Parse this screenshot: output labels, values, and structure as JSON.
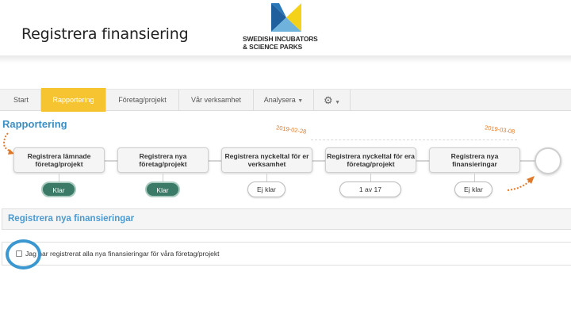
{
  "slide": {
    "title": "Registrera finansiering",
    "logo": {
      "line1": "SWEDISH INCUBATORS",
      "line2": "& SCIENCE PARKS"
    }
  },
  "colors": {
    "accent_yellow": "#f5c430",
    "title_blue": "#3c8fc4",
    "done_green": "#3b7a66",
    "annotation_orange": "#e07a2a",
    "highlight_blue": "#3a97cf"
  },
  "nav": {
    "items": [
      {
        "label": "Start"
      },
      {
        "label": "Rapportering",
        "active": true
      },
      {
        "label": "Företag/projekt"
      },
      {
        "label": "Vår verksamhet"
      },
      {
        "label": "Analysera",
        "caret": "▼"
      },
      {
        "icon": "gear-icon",
        "caret": "▼"
      }
    ]
  },
  "section_title": "Rapportering",
  "dates": {
    "start": "2019-02-28",
    "end": "2019-03-08"
  },
  "steps": [
    {
      "label": "Registrera lämnade företag/projekt",
      "status": "Klar"
    },
    {
      "label": "Registrera nya företag/projekt",
      "status": "Klar"
    },
    {
      "label": "Registrera nyckeltal för er verksamhet",
      "status": "Ej klar"
    },
    {
      "label": "Registrera nyckeltal för era företag/projekt",
      "status": "1 av 17"
    },
    {
      "label": "Registrera nya finansieringar",
      "status": "Ej klar"
    }
  ],
  "form": {
    "title": "Registrera nya finansieringar",
    "checkbox_label": "Jag har registrerat alla nya finansieringar för våra företag/projekt",
    "checked": false
  }
}
